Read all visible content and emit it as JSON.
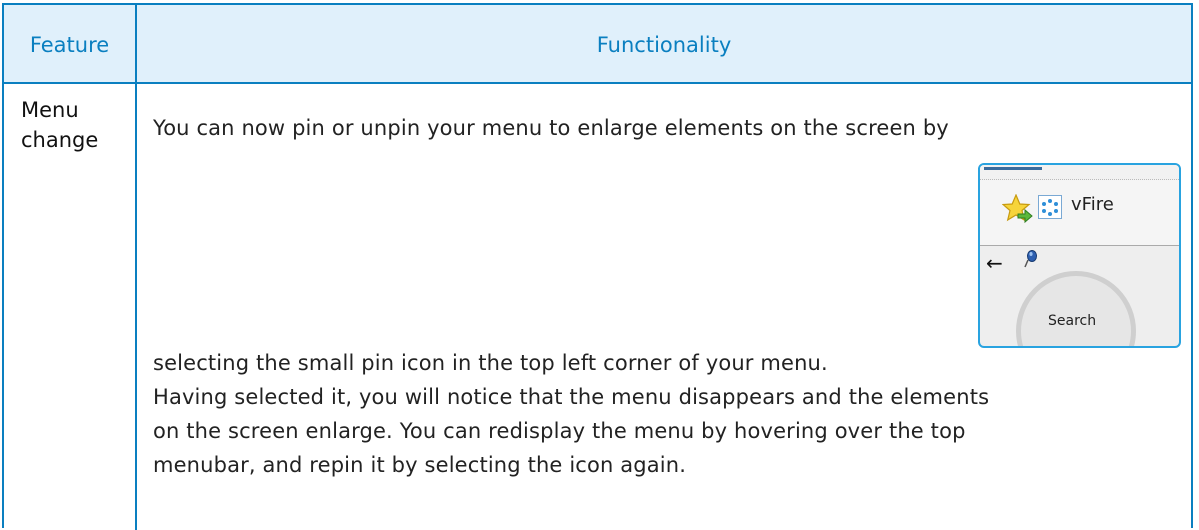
{
  "table": {
    "header": {
      "feature": "Feature",
      "functionality": "Functionality"
    },
    "row": {
      "feature_line1": "Menu",
      "feature_line2": "change",
      "line1": "You can now pin or unpin your menu to enlarge elements on the screen by",
      "line2": "selecting the small pin icon in the top left corner of your menu.",
      "line3": " Having selected it, you will notice that the menu disappears and the elements",
      "line4": "on the screen enlarge. You can redisplay the menu by hovering over the top",
      "line5": "menubar, and repin it by selecting the icon again."
    }
  },
  "screenshot": {
    "app_label": "vFire",
    "search_label": "Search",
    "back_arrow": "←",
    "icons": [
      "favorite-star-icon",
      "vfire-logo-icon",
      "back-arrow-icon",
      "pin-icon"
    ]
  },
  "colors": {
    "border": "#0a7fc0",
    "header_bg": "#e0f0fb",
    "header_text": "#0a7fc0"
  }
}
